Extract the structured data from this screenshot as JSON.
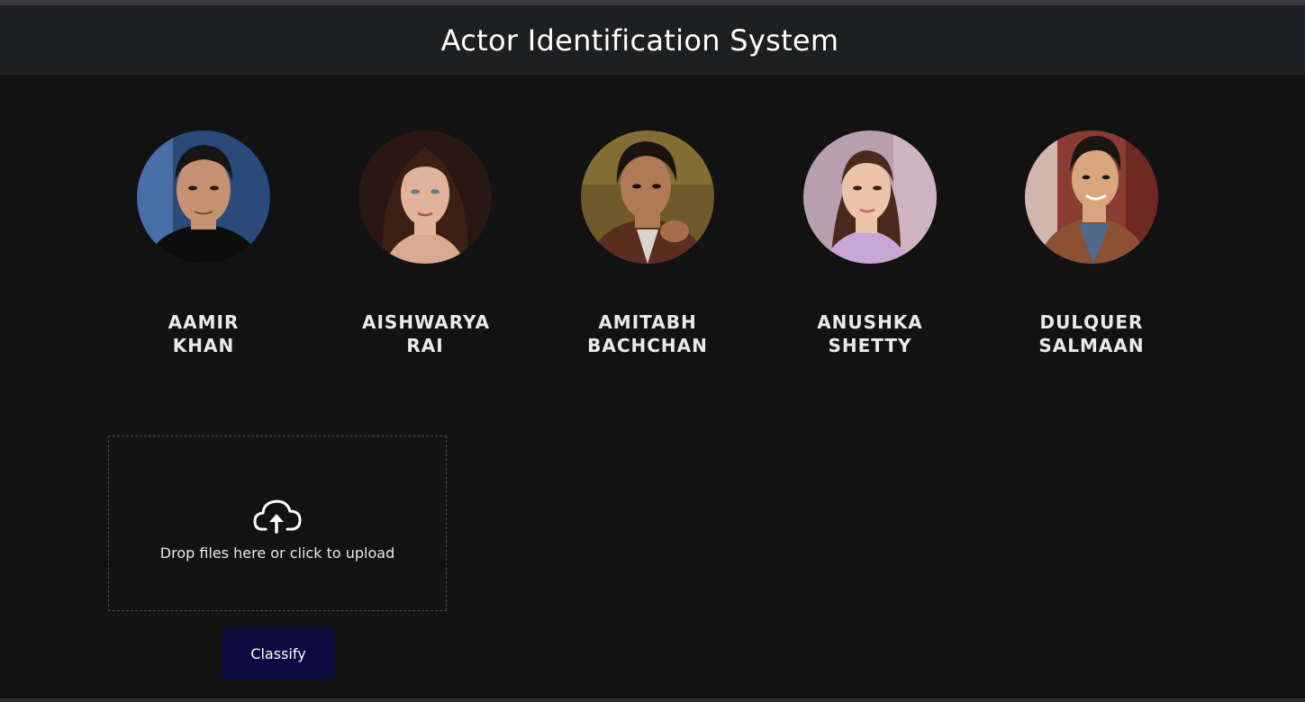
{
  "header": {
    "title": "Actor Identification System"
  },
  "actors": [
    {
      "name": "AAMIR KHAN",
      "portrait_bg": "#2a4a7a",
      "skin": "#c69170",
      "hair": "#151515",
      "cloth": "#0d0d0d"
    },
    {
      "name": "AISHWARYA RAI",
      "portrait_bg": "#2b1712",
      "skin": "#e0b39a",
      "hair": "#3b2015",
      "cloth": "#d9a990"
    },
    {
      "name": "AMITABH BACHCHAN",
      "portrait_bg": "#6e5a2a",
      "skin": "#b07a55",
      "hair": "#1a1410",
      "cloth": "#5a2e1e"
    },
    {
      "name": "ANUSHKA SHETTY",
      "portrait_bg": "#b89fb0",
      "skin": "#ecc4a8",
      "hair": "#4a2a1c",
      "cloth": "#c8a6d6"
    },
    {
      "name": "DULQUER SALMAAN",
      "portrait_bg": "#8a3b32",
      "skin": "#d8a57e",
      "hair": "#1b1512",
      "cloth": "#8a5133"
    }
  ],
  "upload": {
    "icon": "cloud-upload-icon",
    "text": "Drop files here or click to upload"
  },
  "actions": {
    "classify_label": "Classify"
  },
  "colors": {
    "background": "#121212",
    "header_bg": "#1e1f21",
    "button_bg": "#0b0b40"
  }
}
